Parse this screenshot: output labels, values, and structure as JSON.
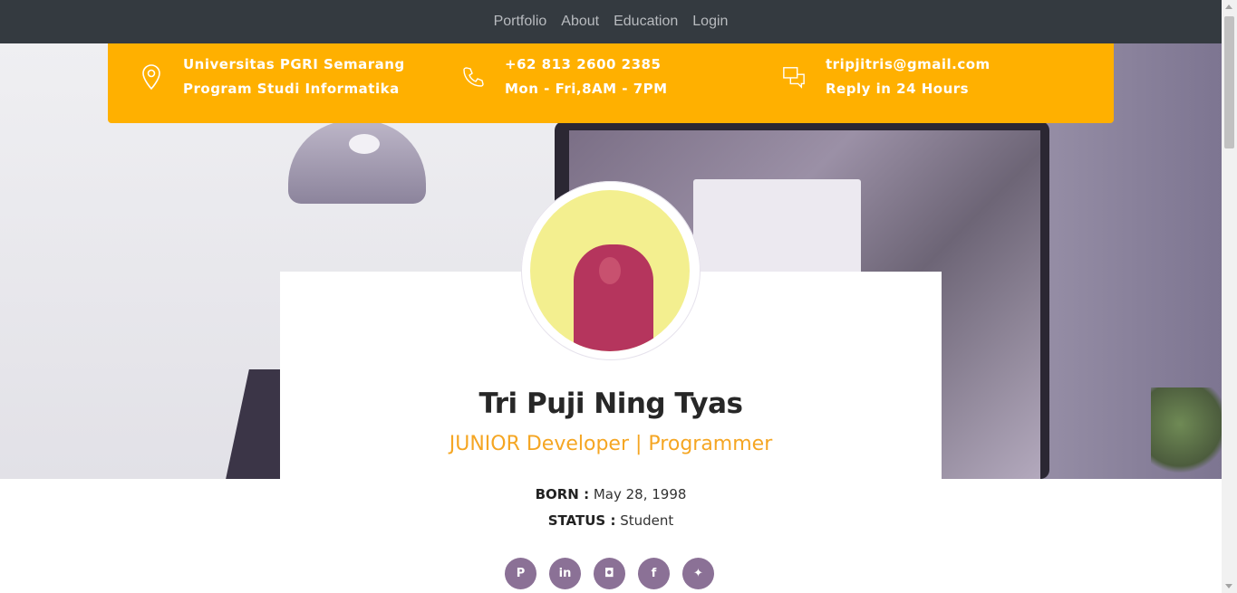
{
  "nav": {
    "items": [
      {
        "label": "Portfolio"
      },
      {
        "label": "About"
      },
      {
        "label": "Education"
      },
      {
        "label": "Login"
      }
    ]
  },
  "contact": {
    "location": {
      "line1": "Universitas PGRI Semarang",
      "line2": "Program Studi Informatika",
      "icon": "map-pin-icon"
    },
    "phone": {
      "line1": "+62 813 2600 2385",
      "line2": "Mon - Fri,8AM - 7PM",
      "icon": "phone-icon"
    },
    "email": {
      "line1": "tripjitris@gmail.com",
      "line2": "Reply in 24 Hours",
      "icon": "chat-icon"
    },
    "bar_color": "#ffb000"
  },
  "profile": {
    "name": "Tri Puji Ning Tyas",
    "role": "JUNIOR Developer | Programmer",
    "born_label": "BORN :",
    "born_value": "May 28, 1998",
    "status_label": "STATUS :",
    "status_value": "Student",
    "accent_color": "#f5a623"
  },
  "socials": [
    {
      "name": "pinterest",
      "glyph": "P"
    },
    {
      "name": "linkedin",
      "glyph": "in"
    },
    {
      "name": "instagram",
      "glyph": "◘"
    },
    {
      "name": "facebook",
      "glyph": "f"
    },
    {
      "name": "twitter",
      "glyph": "✦"
    }
  ]
}
